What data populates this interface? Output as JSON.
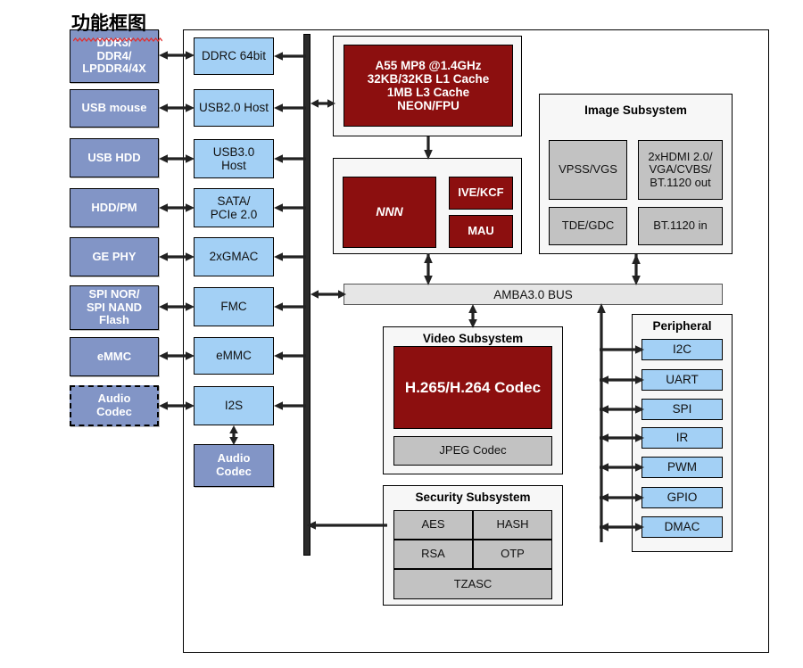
{
  "title": "功能框图",
  "colors": {
    "external_block": "#8295c6",
    "interface_block": "#a3d0f5",
    "core_block": "#8c0f0f",
    "gray_block": "#c2c2c2",
    "bus_bar": "#e6e6e6",
    "vertical_bus": "#2b2b2b",
    "panel_bg": "#f7f7f7"
  },
  "external_blocks": [
    {
      "label": "DDR3/\nDDR4/\nLPDDR4/4X",
      "style": "solid"
    },
    {
      "label": "USB mouse",
      "style": "solid"
    },
    {
      "label": "USB HDD",
      "style": "solid"
    },
    {
      "label": "HDD/PM",
      "style": "solid"
    },
    {
      "label": "GE PHY",
      "style": "solid"
    },
    {
      "label": "SPI NOR/\nSPI NAND\nFlash",
      "style": "solid"
    },
    {
      "label": "eMMC",
      "style": "solid"
    },
    {
      "label": "Audio\nCodec",
      "style": "dashed"
    }
  ],
  "interface_blocks": [
    {
      "label": "DDRC 64bit"
    },
    {
      "label": "USB2.0 Host"
    },
    {
      "label": "USB3.0\nHost"
    },
    {
      "label": "SATA/\nPCIe 2.0"
    },
    {
      "label": "2xGMAC"
    },
    {
      "label": "FMC"
    },
    {
      "label": "eMMC"
    },
    {
      "label": "I2S"
    }
  ],
  "audio_codec_internal": {
    "label": "Audio\nCodec"
  },
  "cpu": {
    "label": "A55 MP8 @1.4GHz\n32KB/32KB L1 Cache\n1MB L3 Cache\nNEON/FPU"
  },
  "accelerators": {
    "nnn": "NNN",
    "ive": "IVE/KCF",
    "mau": "MAU"
  },
  "image_subsystem": {
    "title": "Image Subsystem",
    "blocks": [
      {
        "label": "VPSS/VGS"
      },
      {
        "label": "2xHDMI 2.0/\nVGA/CVBS/\nBT.1120 out"
      },
      {
        "label": "TDE/GDC"
      },
      {
        "label": "BT.1120 in"
      }
    ]
  },
  "bus": {
    "label": "AMBA3.0 BUS"
  },
  "video_subsystem": {
    "title": "Video Subsystem",
    "codec": "H.265/H.264 Codec",
    "jpeg": "JPEG Codec"
  },
  "security_subsystem": {
    "title": "Security Subsystem",
    "blocks": [
      {
        "label": "AES"
      },
      {
        "label": "HASH"
      },
      {
        "label": "RSA"
      },
      {
        "label": "OTP"
      },
      {
        "label": "TZASC"
      }
    ]
  },
  "peripheral": {
    "title": "Peripheral",
    "blocks": [
      {
        "label": "I2C"
      },
      {
        "label": "UART"
      },
      {
        "label": "SPI"
      },
      {
        "label": "IR"
      },
      {
        "label": "PWM"
      },
      {
        "label": "GPIO"
      },
      {
        "label": "DMAC"
      }
    ]
  }
}
